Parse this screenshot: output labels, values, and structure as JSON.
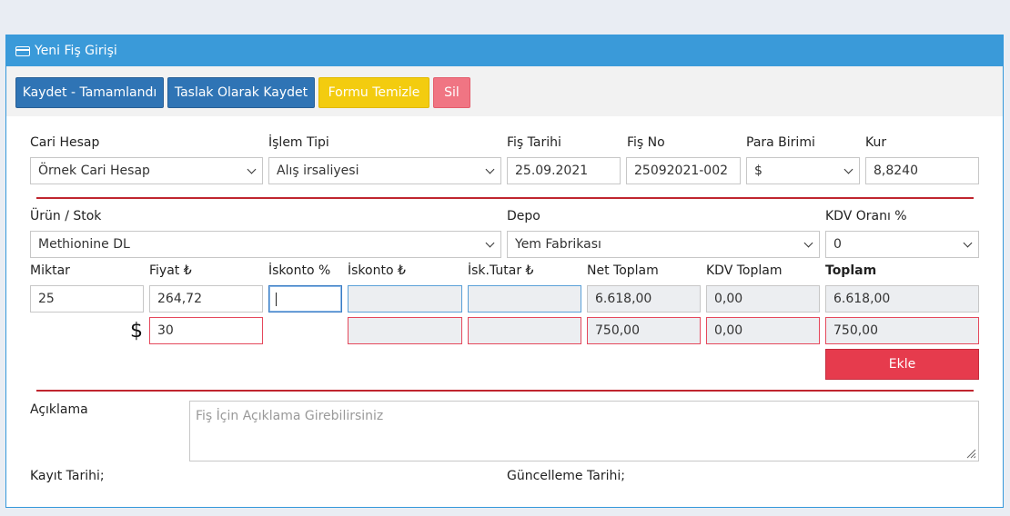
{
  "panel": {
    "title": "Yeni Fiş Girişi"
  },
  "toolbar": {
    "save_complete": "Kaydet - Tamamlandı",
    "save_draft": "Taslak Olarak Kaydet",
    "clear_form": "Formu Temizle",
    "delete": "Sil"
  },
  "header_fields": {
    "cari_hesap": {
      "label": "Cari Hesap",
      "value": "Örnek Cari Hesap"
    },
    "islem_tipi": {
      "label": "İşlem Tipi",
      "value": "Alış irsaliyesi"
    },
    "fis_tarihi": {
      "label": "Fiş Tarihi",
      "value": "25.09.2021"
    },
    "fis_no": {
      "label": "Fiş No",
      "value": "25092021-002"
    },
    "para_birimi": {
      "label": "Para Birimi",
      "value": "$"
    },
    "kur": {
      "label": "Kur",
      "value": "8,8240"
    }
  },
  "product": {
    "urun": {
      "label": "Ürün / Stok",
      "value": "Methionine DL"
    },
    "depo": {
      "label": "Depo",
      "value": "Yem Fabrikası"
    },
    "kdv_orani": {
      "label": "KDV Oranı %",
      "value": "0"
    }
  },
  "line": {
    "labels": {
      "miktar": "Miktar",
      "fiyat": "Fiyat ₺",
      "iskonto_pct": "İskonto %",
      "iskonto_tl": "İskonto ₺",
      "isk_tutar": "İsk.Tutar ₺",
      "net_toplam": "Net Toplam",
      "kdv_toplam": "KDV Toplam",
      "toplam": "Toplam"
    },
    "tl_row": {
      "miktar": "25",
      "fiyat": "264,72",
      "iskonto_pct": "",
      "iskonto_tl": "",
      "isk_tutar": "",
      "net_toplam": "6.618,00",
      "kdv_toplam": "0,00",
      "toplam": "6.618,00"
    },
    "currency_row": {
      "symbol": "$",
      "fiyat": "30",
      "iskonto_tl": "",
      "isk_tutar": "",
      "net_toplam": "750,00",
      "kdv_toplam": "0,00",
      "toplam": "750,00"
    },
    "add_button": "Ekle"
  },
  "notes": {
    "label": "Açıklama",
    "placeholder": "Fiş İçin Açıklama Girebilirsiniz",
    "kayit_tarihi": "Kayıt Tarihi;",
    "guncelleme_tarihi": "Güncelleme Tarihi;"
  },
  "colors": {
    "header_blue": "#3a9ad9",
    "button_blue": "#2f74b5",
    "button_yellow": "#f3cc0f",
    "button_pink": "#f07583",
    "danger_red": "#e63b4d",
    "divider_red": "#c0262f"
  }
}
